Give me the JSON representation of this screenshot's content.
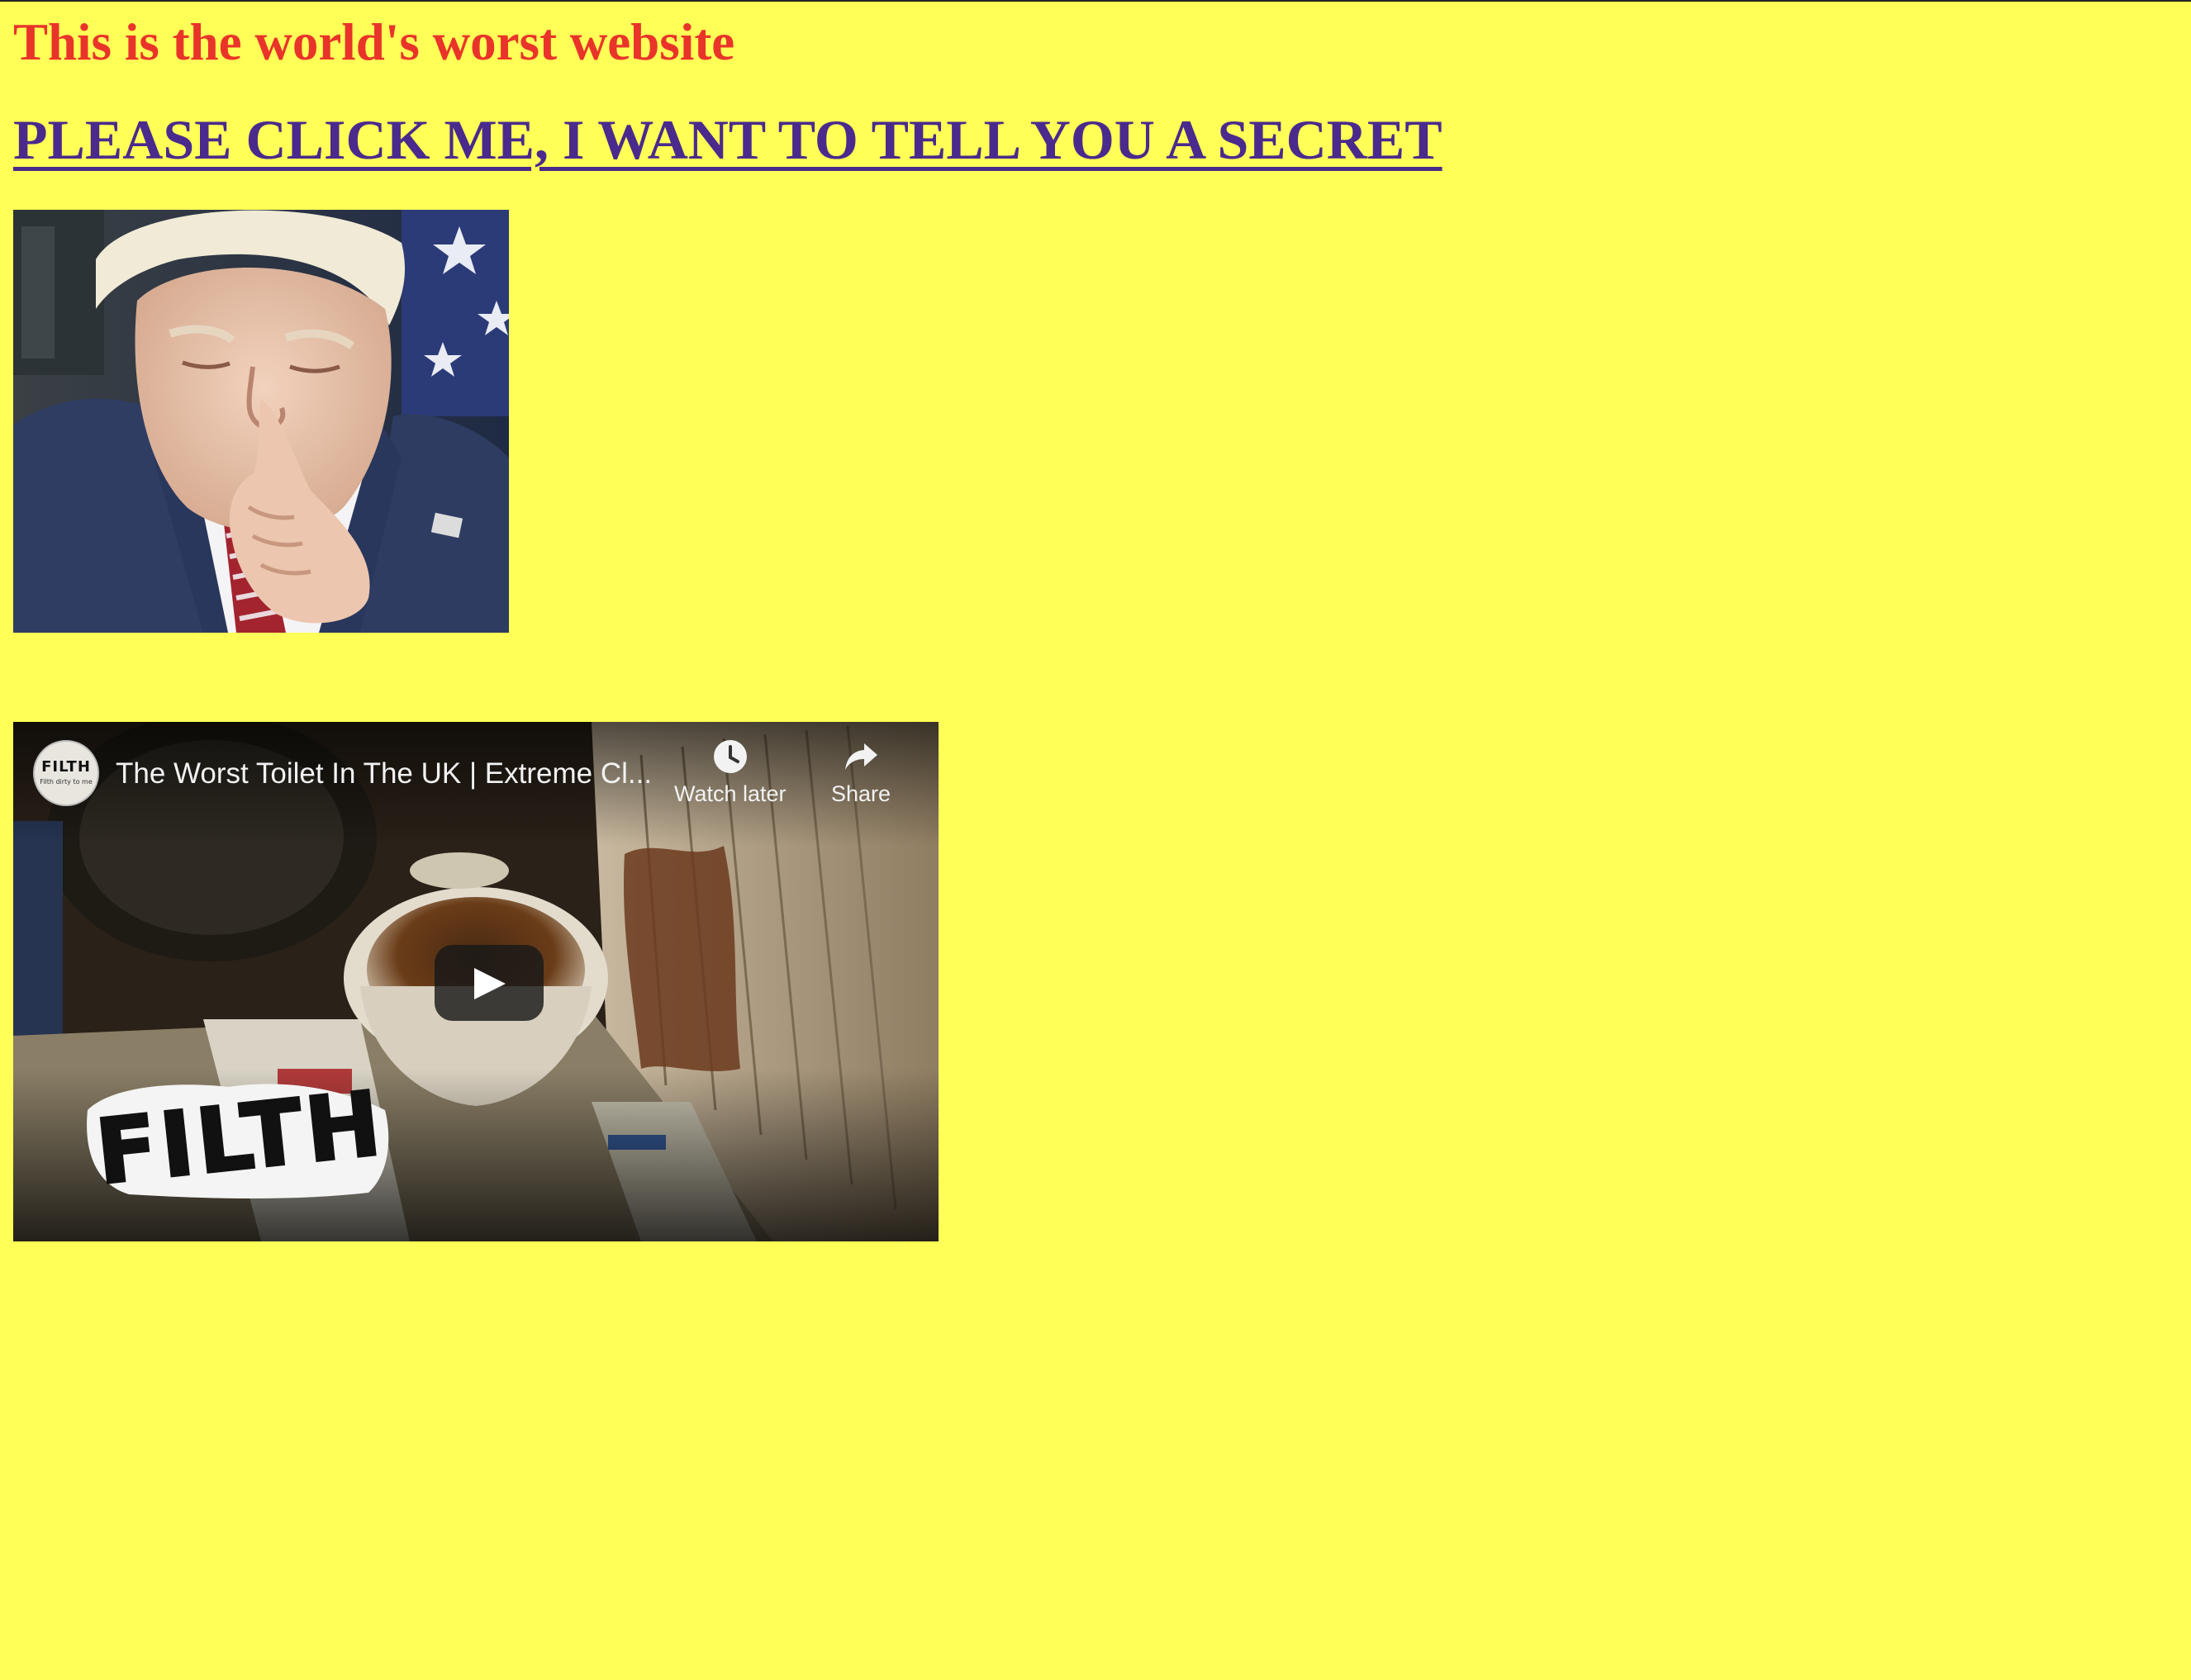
{
  "page": {
    "title": "This is the world's worst website",
    "secret_link": "PLEASE CLICK ME, I WANT TO TELL YOU A SECRET"
  },
  "colors": {
    "background": "#ffff57",
    "title": "#e9342a",
    "link": "#4a2a8c"
  },
  "video": {
    "title": "The Worst Toilet In The UK | Extreme Cl...",
    "channel_avatar_text": "FILTH",
    "channel_avatar_sub": "Filth dirty to me",
    "watch_later_label": "Watch later",
    "share_label": "Share",
    "logo_text": "FILTH",
    "icons": {
      "watch_later": "clock-icon",
      "share": "share-arrow-icon",
      "play": "play-icon"
    }
  }
}
